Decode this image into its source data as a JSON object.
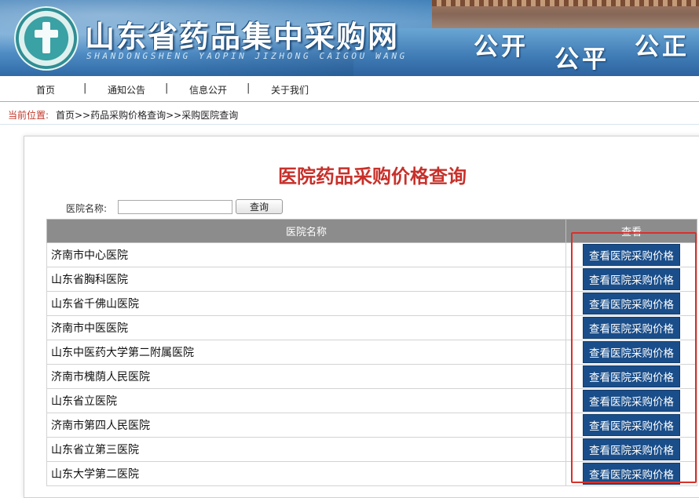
{
  "header": {
    "site_title": "山东省药品集中采购网",
    "site_subtitle": "SHANDONGSHENG YAOPIN JIZHONG CAIGOU WANG",
    "slogans": [
      "公开",
      "公平",
      "公正"
    ]
  },
  "nav": {
    "items": [
      {
        "label": "首页"
      },
      {
        "label": "通知公告"
      },
      {
        "label": "信息公开"
      },
      {
        "label": "关于我们"
      }
    ],
    "separator": "|"
  },
  "breadcrumb": {
    "label": "当前位置:",
    "path": "首页>>药品采购价格查询>>采购医院查询"
  },
  "page": {
    "title": "医院药品采购价格查询"
  },
  "search": {
    "label": "医院名称:",
    "value": "",
    "button_label": "查询"
  },
  "table": {
    "columns": [
      "医院名称",
      "查看"
    ],
    "action_label": "查看医院采购价格",
    "rows": [
      {
        "name": "济南市中心医院"
      },
      {
        "name": "山东省胸科医院"
      },
      {
        "name": "山东省千佛山医院"
      },
      {
        "name": "济南市中医医院"
      },
      {
        "name": "山东中医药大学第二附属医院"
      },
      {
        "name": "济南市槐荫人民医院"
      },
      {
        "name": "山东省立医院"
      },
      {
        "name": "济南市第四人民医院"
      },
      {
        "name": "山东省立第三医院"
      },
      {
        "name": "山东大学第二医院"
      }
    ]
  },
  "colors": {
    "title_red": "#c8302a",
    "action_blue": "#1a4e8a",
    "header_gray": "#8c8c8c",
    "highlight_red": "#d9302a"
  }
}
